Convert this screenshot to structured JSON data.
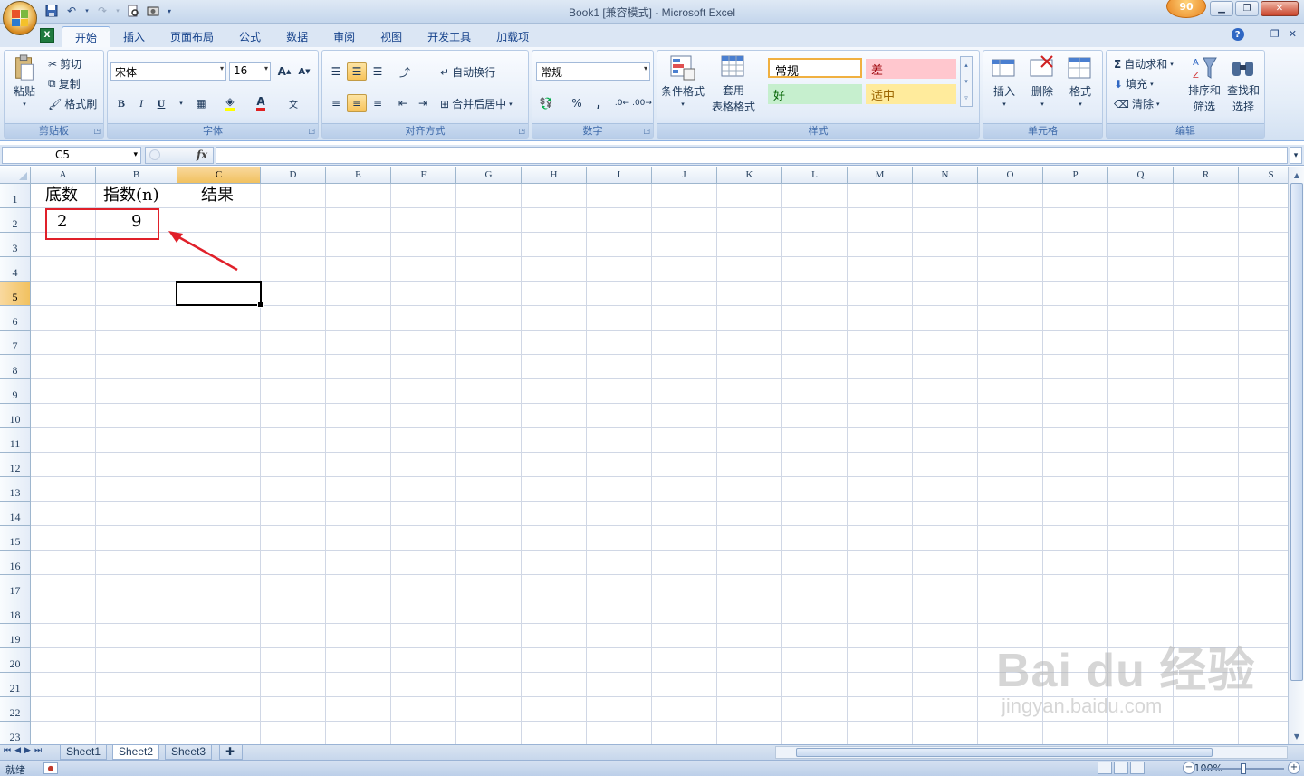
{
  "window": {
    "title": "Book1  [兼容模式] - Microsoft Excel",
    "badge": "90"
  },
  "tabs": [
    "开始",
    "插入",
    "页面布局",
    "公式",
    "数据",
    "审阅",
    "视图",
    "开发工具",
    "加载项"
  ],
  "active_tab_index": 0,
  "ribbon": {
    "clipboard": {
      "paste": "粘贴",
      "cut": "剪切",
      "copy": "复制",
      "format_painter": "格式刷",
      "label": "剪贴板"
    },
    "font": {
      "name": "宋体",
      "size": "16",
      "label": "字体",
      "bold": "B",
      "italic": "I",
      "underline": "U"
    },
    "alignment": {
      "wrap": "自动换行",
      "merge": "合并后居中",
      "label": "对齐方式"
    },
    "number": {
      "format": "常规",
      "percent": "%",
      "comma": ",",
      "label": "数字"
    },
    "styles": {
      "conditional": "条件格式",
      "table_format_1": "套用",
      "table_format_2": "表格格式",
      "cells": [
        {
          "text": "常规",
          "bg": "#ffffff",
          "color": "#000000"
        },
        {
          "text": "差",
          "bg": "#ffc7ce",
          "color": "#9c0006"
        },
        {
          "text": "好",
          "bg": "#c6efce",
          "color": "#006100"
        },
        {
          "text": "适中",
          "bg": "#ffeb9c",
          "color": "#9c6500"
        }
      ],
      "label": "样式"
    },
    "cells": {
      "insert": "插入",
      "delete": "删除",
      "format": "格式",
      "label": "单元格"
    },
    "editing": {
      "autosum": "自动求和",
      "fill": "填充",
      "clear": "清除",
      "sort_1": "排序和",
      "sort_2": "筛选",
      "find_1": "查找和",
      "find_2": "选择",
      "label": "编辑"
    }
  },
  "formula_bar": {
    "name_box": "C5",
    "fx": "fx",
    "formula": ""
  },
  "columns": [
    "A",
    "B",
    "C",
    "D",
    "E",
    "F",
    "G",
    "H",
    "I",
    "J",
    "K",
    "L",
    "M",
    "N",
    "O",
    "P",
    "Q",
    "R",
    "S"
  ],
  "selected_column": "C",
  "rows": [
    "1",
    "2",
    "3",
    "4",
    "5",
    "6",
    "7",
    "8",
    "9",
    "10",
    "11",
    "12",
    "13",
    "14",
    "15",
    "16",
    "17",
    "18",
    "19",
    "20",
    "21",
    "22",
    "23"
  ],
  "selected_row": "5",
  "cells": {
    "A1": "底数",
    "B1": "指数(n)",
    "C1": "结果",
    "A2": "2",
    "B2": "9"
  },
  "sheets": [
    "Sheet1",
    "Sheet2",
    "Sheet3"
  ],
  "active_sheet_index": 1,
  "status": {
    "ready": "就绪",
    "zoom": "100%"
  },
  "watermark": {
    "line1": "Bai du 经验",
    "line2": "jingyan.baidu.com"
  },
  "colors": {
    "annotation_red": "#e0202a",
    "selection_header": "#f1c15f"
  }
}
